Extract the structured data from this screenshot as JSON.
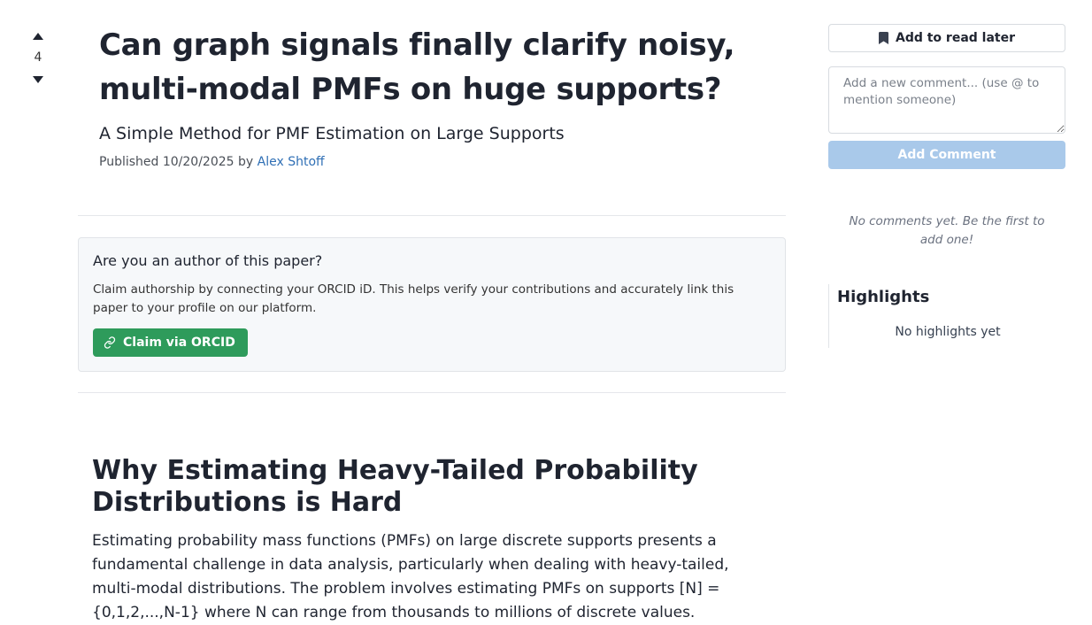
{
  "vote": {
    "count": "4",
    "upvote_icon": "triangle-up-icon",
    "downvote_icon": "triangle-down-icon"
  },
  "paper": {
    "title": "Can graph signals finally clarify noisy, multi-modal PMFs on huge supports?",
    "subtitle": "A Simple Method for PMF Estimation on Large Supports",
    "published_prefix": "Published 10/20/2025 by",
    "author": "Alex Shtoff"
  },
  "claim": {
    "heading": "Are you an author of this paper?",
    "description": "Claim authorship by connecting your ORCID iD. This helps verify your contributions and accurately link this paper to your profile on our platform.",
    "button_label": "Claim via ORCID",
    "button_icon": "link-icon",
    "button_color": "#2e9b5b"
  },
  "article": {
    "heading": "Why Estimating Heavy-Tailed Probability Distributions is Hard",
    "paragraph": "Estimating probability mass functions (PMFs) on large discrete supports presents a fundamental challenge in data analysis, particularly when dealing with heavy-tailed, multi-modal distributions. The problem involves estimating PMFs on supports [N] = {0,1,2,...,N-1} where N can range from thousands to millions of discrete values."
  },
  "sidebar": {
    "read_later_label": "Add to read later",
    "read_later_icon": "bookmark-icon",
    "comment_placeholder": "Add a new comment... (use @ to mention someone)",
    "add_comment_label": "Add Comment",
    "no_comments_text": "No comments yet. Be the first to add one!",
    "highlights_title": "Highlights",
    "no_highlights_text": "No highlights yet"
  },
  "colors": {
    "accent": "#2f6fb5",
    "claim_button": "#2e9b5b",
    "add_comment_disabled": "#a9c9ea"
  }
}
